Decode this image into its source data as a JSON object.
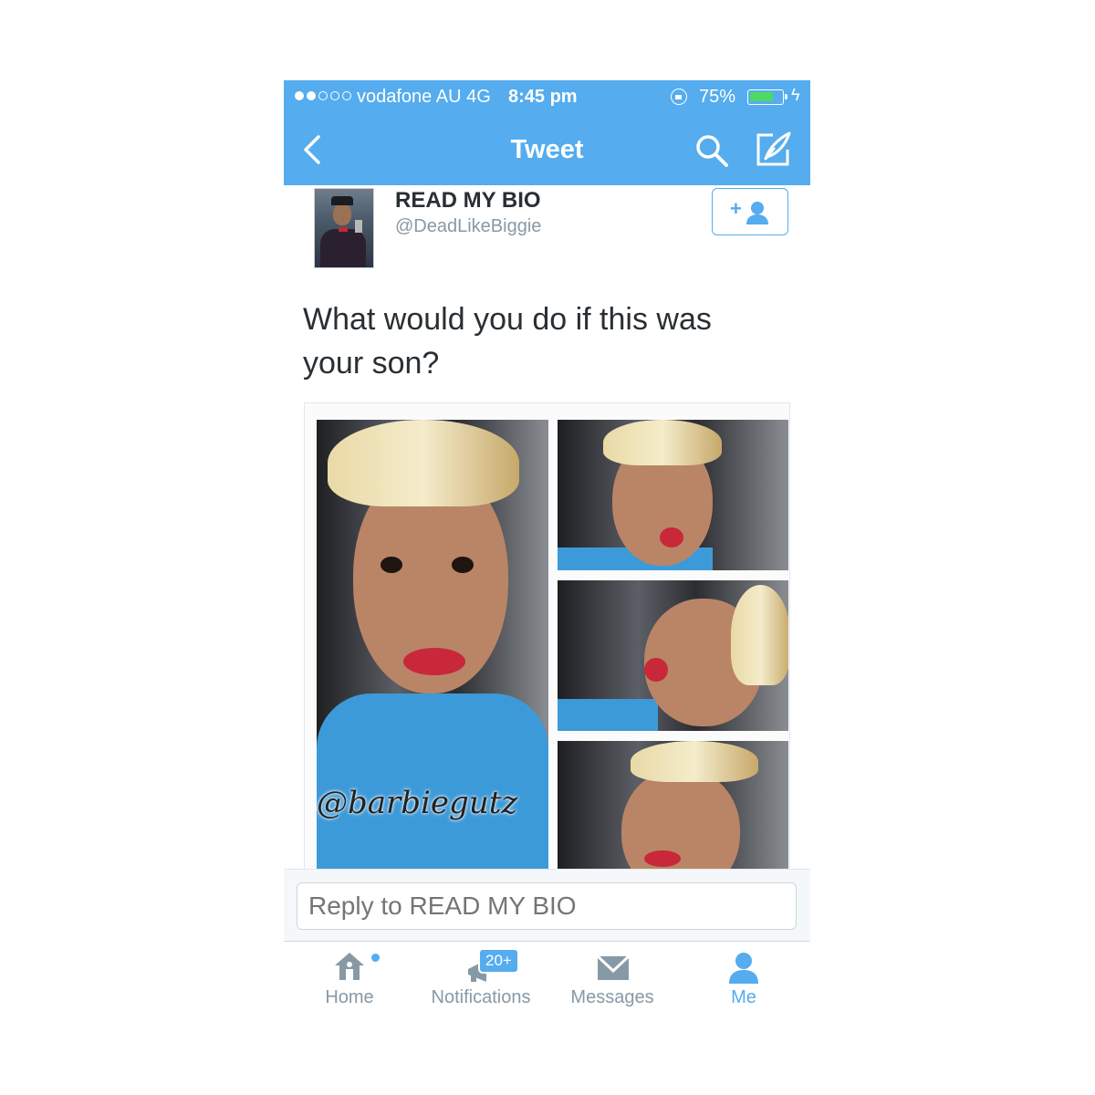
{
  "status_bar": {
    "carrier": "vodafone AU",
    "network": "4G",
    "time": "8:45 pm",
    "battery_percent": "75%",
    "battery_level": 0.75,
    "signal_bars": 2,
    "signal_total": 5
  },
  "nav": {
    "title": "Tweet",
    "back_icon": "chevron-left-icon",
    "search_icon": "search-icon",
    "compose_icon": "compose-icon",
    "accent_color": "#55acee"
  },
  "tweet": {
    "display_name": "READ MY BIO",
    "handle": "@DeadLikeBiggie",
    "follow_button_icon": "add-user-icon",
    "follow_plus": "+",
    "text": "What would you do if this was your son?",
    "media_watermark": "@barbiegutz"
  },
  "reply": {
    "placeholder": "Reply to READ MY BIO"
  },
  "tabbar": {
    "items": [
      {
        "label": "Home",
        "icon": "home-icon",
        "has_unread_dot": true
      },
      {
        "label": "Notifications",
        "icon": "notifications-icon",
        "badge": "20+"
      },
      {
        "label": "Messages",
        "icon": "envelope-icon"
      },
      {
        "label": "Me",
        "icon": "person-icon",
        "active": true
      }
    ]
  }
}
